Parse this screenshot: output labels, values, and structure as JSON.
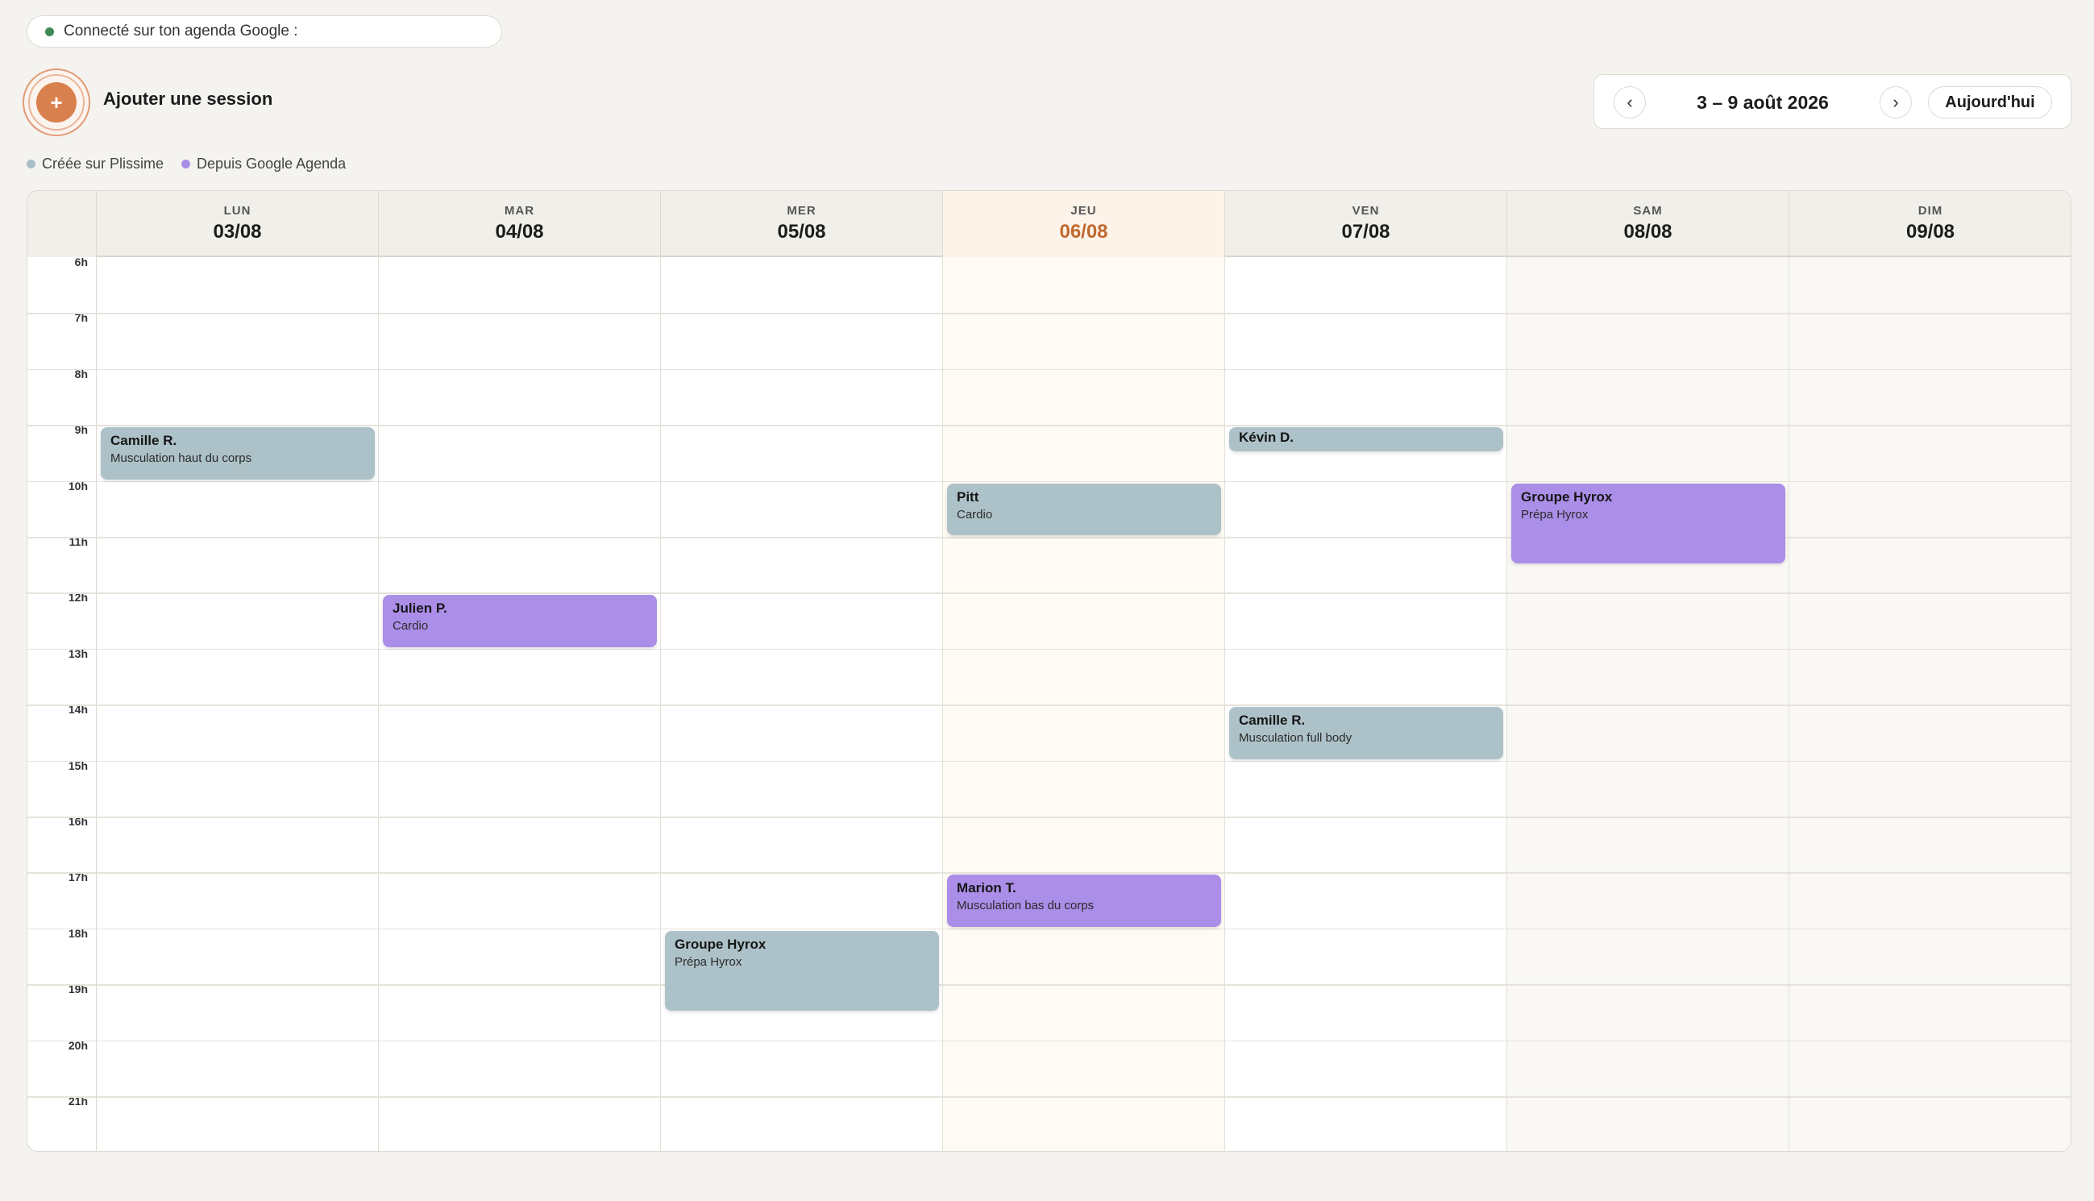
{
  "google_status": {
    "text": "Connecté sur ton agenda Google :",
    "color": "#3e8a55"
  },
  "add_session": {
    "icon": "+",
    "label": "Ajouter une session"
  },
  "week_nav": {
    "prev": "‹",
    "range": "3 – 9 août 2026",
    "next": "›",
    "today": "Aujourd'hui"
  },
  "legend": [
    {
      "label": "Créée sur Plissime",
      "color": "#a9c0c6"
    },
    {
      "label": "Depuis Google Agenda",
      "color": "#a98ee6"
    }
  ],
  "days": [
    {
      "name": "LUN",
      "date": "03/08"
    },
    {
      "name": "MAR",
      "date": "04/08"
    },
    {
      "name": "MER",
      "date": "05/08"
    },
    {
      "name": "JEU",
      "date": "06/08"
    },
    {
      "name": "VEN",
      "date": "07/08"
    },
    {
      "name": "SAM",
      "date": "08/08"
    },
    {
      "name": "DIM",
      "date": "09/08"
    }
  ],
  "today_index": 3,
  "hours": [
    "6h",
    "7h",
    "8h",
    "9h",
    "10h",
    "11h",
    "12h",
    "13h",
    "14h",
    "15h",
    "16h",
    "17h",
    "18h",
    "19h",
    "20h",
    "21h"
  ],
  "events": [
    {
      "day": 0,
      "start": 9,
      "end": 10,
      "title": "Camille R.",
      "subtitle": "Musculation haut du corps",
      "source": "plissime"
    },
    {
      "day": 1,
      "start": 12,
      "end": 13,
      "title": "Julien P.",
      "subtitle": "Cardio",
      "source": "google"
    },
    {
      "day": 2,
      "start": 18,
      "end": 19.5,
      "title": "Groupe Hyrox",
      "subtitle": "Prépa Hyrox",
      "source": "plissime"
    },
    {
      "day": 3,
      "start": 10,
      "end": 11,
      "title": "Pitt",
      "subtitle": "Cardio",
      "source": "plissime"
    },
    {
      "day": 3,
      "start": 17,
      "end": 18,
      "title": "Marion T.",
      "subtitle": "Musculation bas du corps",
      "source": "google"
    },
    {
      "day": 4,
      "start": 9,
      "end": 9.5,
      "title": "Kévin D.",
      "subtitle": "",
      "source": "plissime"
    },
    {
      "day": 4,
      "start": 14,
      "end": 15,
      "title": "Camille R.",
      "subtitle": "Musculation full body",
      "source": "plissime"
    },
    {
      "day": 5,
      "start": 10,
      "end": 11.5,
      "title": "Groupe Hyrox",
      "subtitle": "Prépa Hyrox",
      "source": "google"
    }
  ]
}
